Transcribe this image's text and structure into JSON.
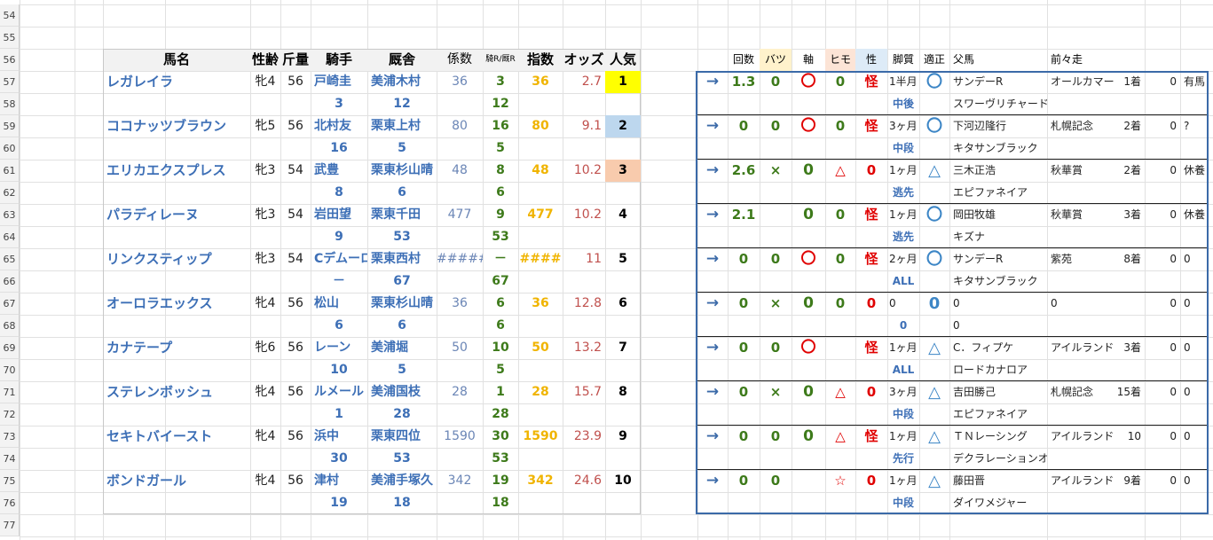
{
  "row_numbers": [
    "54",
    "55",
    "56",
    "57",
    "58",
    "59",
    "60",
    "61",
    "62",
    "63",
    "64",
    "65",
    "66",
    "67",
    "68",
    "69",
    "70",
    "71",
    "72",
    "73",
    "74",
    "75",
    "76",
    "77"
  ],
  "left_headers": {
    "name": "馬名",
    "sexage": "性齢",
    "weight": "斤量",
    "jockey": "騎手",
    "stable": "厩舎",
    "coef": "係数",
    "rank": "騎R/厩R",
    "index": "指数",
    "odds": "オッズ",
    "pop": "人気"
  },
  "right_headers": {
    "kaisu": "回数",
    "batsu": "バツ",
    "jiku": "軸",
    "himo": "ヒモ",
    "sei": "性",
    "kyakushitsu": "脚質",
    "tekisei": "適正",
    "father": "父馬",
    "zenzen": "前々走"
  },
  "colors": {
    "pop1": "#ffff00",
    "pop2": "#bdd7ee",
    "pop3": "#f8cbad",
    "border": "#3b6aa8"
  },
  "horses": [
    {
      "name": "レガレイラ",
      "sexage": "牝4",
      "weight": "56",
      "jockey": "戸崎圭",
      "jockey_rank": "3",
      "stable": "美浦木村",
      "stable_rank": "12",
      "coef": "36",
      "rank1": "3",
      "rank2": "12",
      "index": "36",
      "odds": "2.7",
      "pop": "1",
      "arrow": "→",
      "kaisu": "1.3",
      "batsu": "0",
      "jiku": "〇",
      "himo": "0",
      "sei": "怪",
      "period": "1半月",
      "style": "中後",
      "tekisei": "〇",
      "father": "サンデーR",
      "trainer2": "スワーヴリチャード",
      "race": "オールカマー",
      "pos": "1着",
      "n1": "0",
      "note": "有馬"
    },
    {
      "name": "ココナッツブラウン",
      "sexage": "牝5",
      "weight": "56",
      "jockey": "北村友",
      "jockey_rank": "16",
      "stable": "栗東上村",
      "stable_rank": "5",
      "coef": "80",
      "rank1": "16",
      "rank2": "5",
      "index": "80",
      "odds": "9.1",
      "pop": "2",
      "arrow": "→",
      "kaisu": "0",
      "batsu": "0",
      "jiku": "〇",
      "himo": "0",
      "sei": "怪",
      "period": "3ヶ月",
      "style": "中段",
      "tekisei": "〇",
      "father": "下河辺隆行",
      "trainer2": "キタサンブラック",
      "race": "札幌記念",
      "pos": "2着",
      "n1": "0",
      "note": "?"
    },
    {
      "name": "エリカエクスプレス",
      "sexage": "牝3",
      "weight": "54",
      "jockey": "武豊",
      "jockey_rank": "8",
      "stable": "栗東杉山晴",
      "stable_rank": "6",
      "coef": "48",
      "rank1": "8",
      "rank2": "6",
      "index": "48",
      "odds": "10.2",
      "pop": "3",
      "arrow": "→",
      "kaisu": "2.6",
      "batsu": "×",
      "jiku": "0",
      "himo": "△",
      "sei": "0",
      "period": "1ヶ月",
      "style": "逃先",
      "tekisei": "△",
      "father": "三木正浩",
      "trainer2": "エピファネイア",
      "race": "秋華賞",
      "pos": "2着",
      "n1": "0",
      "note": "休養"
    },
    {
      "name": "パラディレーヌ",
      "sexage": "牝3",
      "weight": "54",
      "jockey": "岩田望",
      "jockey_rank": "9",
      "stable": "栗東千田",
      "stable_rank": "53",
      "coef": "477",
      "rank1": "9",
      "rank2": "53",
      "index": "477",
      "odds": "10.2",
      "pop": "4",
      "arrow": "→",
      "kaisu": "2.1",
      "batsu": "",
      "jiku": "0",
      "himo": "0",
      "sei": "怪",
      "period": "1ヶ月",
      "style": "逃先",
      "tekisei": "〇",
      "father": "岡田牧雄",
      "trainer2": "キズナ",
      "race": "秋華賞",
      "pos": "3着",
      "n1": "0",
      "note": "休養"
    },
    {
      "name": "リンクスティップ",
      "sexage": "牝3",
      "weight": "54",
      "jockey": "Cデムーロ",
      "jockey_rank": "－",
      "stable": "栗東西村",
      "stable_rank": "67",
      "coef": "#####",
      "rank1": "－",
      "rank2": "67",
      "index": "####",
      "odds": "11",
      "pop": "5",
      "arrow": "→",
      "kaisu": "0",
      "batsu": "0",
      "jiku": "〇",
      "himo": "0",
      "sei": "怪",
      "period": "2ヶ月",
      "style": "ALL",
      "tekisei": "〇",
      "father": "サンデーR",
      "trainer2": "キタサンブラック",
      "race": "紫苑",
      "pos": "8着",
      "n1": "0",
      "note": "0"
    },
    {
      "name": "オーロラエックス",
      "sexage": "牝4",
      "weight": "56",
      "jockey": "松山",
      "jockey_rank": "6",
      "stable": "栗東杉山晴",
      "stable_rank": "6",
      "coef": "36",
      "rank1": "6",
      "rank2": "6",
      "index": "36",
      "odds": "12.8",
      "pop": "6",
      "arrow": "→",
      "kaisu": "0",
      "batsu": "×",
      "jiku": "0",
      "himo": "0",
      "sei": "0",
      "period": "0",
      "style": "0",
      "tekisei": "0",
      "father": "0",
      "trainer2": "0",
      "race": "0",
      "pos": "",
      "n1": "0",
      "note": "0"
    },
    {
      "name": "カナテープ",
      "sexage": "牝6",
      "weight": "56",
      "jockey": "レーン",
      "jockey_rank": "10",
      "stable": "美浦堀",
      "stable_rank": "5",
      "coef": "50",
      "rank1": "10",
      "rank2": "5",
      "index": "50",
      "odds": "13.2",
      "pop": "7",
      "arrow": "→",
      "kaisu": "0",
      "batsu": "0",
      "jiku": "〇",
      "himo": "",
      "sei": "怪",
      "period": "1ヶ月",
      "style": "ALL",
      "tekisei": "△",
      "father": "C．フィプケ",
      "trainer2": "ロードカナロア",
      "race": "アイルランド",
      "pos": "3着",
      "n1": "0",
      "note": "0"
    },
    {
      "name": "ステレンボッシュ",
      "sexage": "牝4",
      "weight": "56",
      "jockey": "ルメール",
      "jockey_rank": "1",
      "stable": "美浦国枝",
      "stable_rank": "28",
      "coef": "28",
      "rank1": "1",
      "rank2": "28",
      "index": "28",
      "odds": "15.7",
      "pop": "8",
      "arrow": "→",
      "kaisu": "0",
      "batsu": "×",
      "jiku": "0",
      "himo": "△",
      "sei": "0",
      "period": "3ヶ月",
      "style": "中段",
      "tekisei": "△",
      "father": "吉田勝己",
      "trainer2": "エピファネイア",
      "race": "札幌記念",
      "pos": "15着",
      "n1": "0",
      "note": "0"
    },
    {
      "name": "セキトバイースト",
      "sexage": "牝4",
      "weight": "56",
      "jockey": "浜中",
      "jockey_rank": "30",
      "stable": "栗東四位",
      "stable_rank": "53",
      "coef": "1590",
      "rank1": "30",
      "rank2": "53",
      "index": "1590",
      "odds": "23.9",
      "pop": "9",
      "arrow": "→",
      "kaisu": "0",
      "batsu": "0",
      "jiku": "0",
      "himo": "△",
      "sei": "怪",
      "period": "1ヶ月",
      "style": "先行",
      "tekisei": "△",
      "father": "ＴＮレーシング",
      "trainer2": "デクラレーションオブウォー",
      "race": "アイルランド",
      "pos": "10",
      "n1": "0",
      "note": "0"
    },
    {
      "name": "ボンドガール",
      "sexage": "牝4",
      "weight": "56",
      "jockey": "津村",
      "jockey_rank": "19",
      "stable": "美浦手塚久",
      "stable_rank": "18",
      "coef": "342",
      "rank1": "19",
      "rank2": "18",
      "index": "342",
      "odds": "24.6",
      "pop": "10",
      "arrow": "→",
      "kaisu": "0",
      "batsu": "0",
      "jiku": "",
      "himo": "☆",
      "sei": "0",
      "period": "1ヶ月",
      "style": "中段",
      "tekisei": "△",
      "father": "藤田晋",
      "trainer2": "ダイワメジャー",
      "race": "アイルランド",
      "pos": "9着",
      "n1": "0",
      "note": "0"
    }
  ]
}
